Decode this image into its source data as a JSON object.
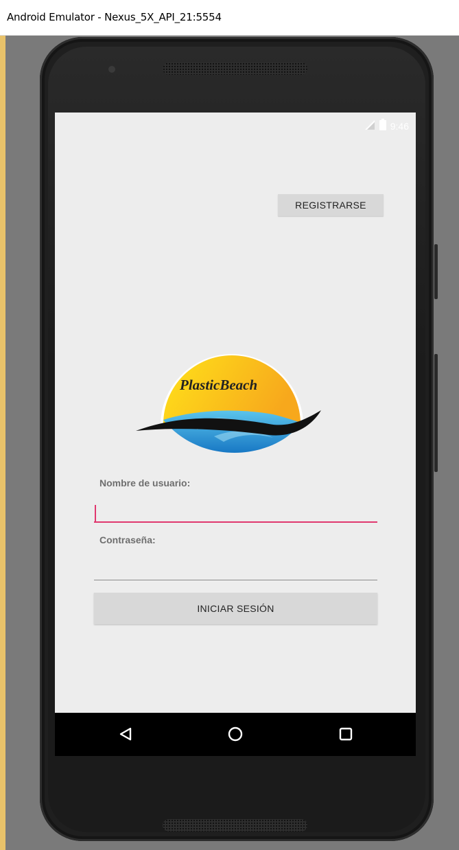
{
  "window": {
    "title": "Android Emulator - Nexus_5X_API_21:5554"
  },
  "status_bar": {
    "time": "9:46",
    "icons": [
      "signal-icon",
      "battery-icon"
    ]
  },
  "buttons": {
    "register": "REGISTRARSE",
    "login": "INICIAR SESIÓN"
  },
  "logo": {
    "text": "PlasticBeach"
  },
  "form": {
    "username": {
      "label": "Nombre de usuario:",
      "value": ""
    },
    "password": {
      "label": "Contraseña:",
      "value": ""
    }
  },
  "nav_bar": {
    "icons": [
      "back-icon",
      "home-icon",
      "recents-icon"
    ]
  },
  "colors": {
    "accent": "#e0376e",
    "screen_bg": "#ededed",
    "button_bg": "#d8d8d8",
    "sun": "#f7c21a",
    "water": "#2b9ad6"
  }
}
